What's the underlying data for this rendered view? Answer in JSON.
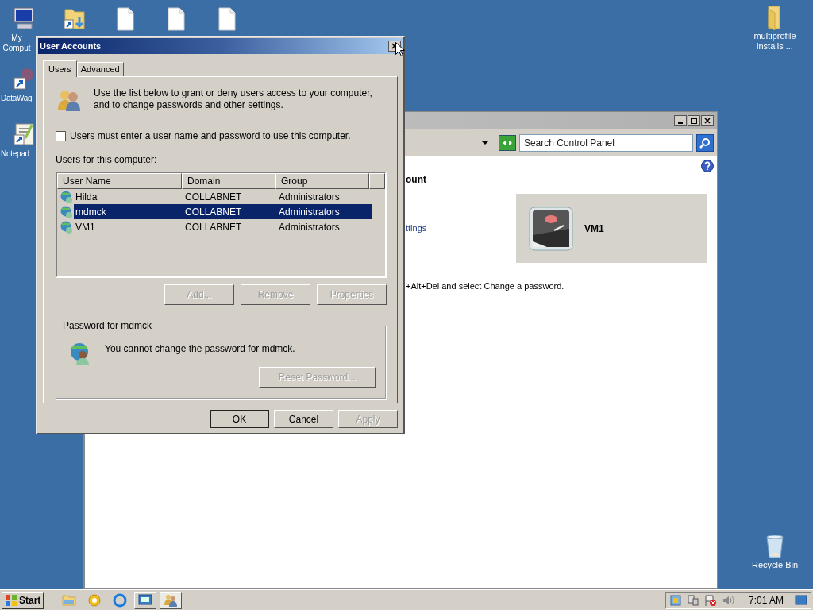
{
  "desktop_icons": [
    {
      "label": "My Comput",
      "kind": "computer"
    },
    {
      "kind": "folder-shortcut"
    },
    {
      "kind": "file"
    },
    {
      "kind": "file"
    },
    {
      "kind": "file"
    },
    {
      "label": "DataWag",
      "kind": "shortcut"
    },
    {
      "label": "Notepad",
      "kind": "notepad"
    },
    {
      "label": "multiprofile installs ...",
      "kind": "folder"
    },
    {
      "label": "Recycle Bin",
      "kind": "recycle"
    }
  ],
  "background_window": {
    "search": {
      "placeholder": "Search Control Panel"
    },
    "heading": "ount",
    "link": "ttings",
    "account": {
      "name": "VM1"
    },
    "note": "+Alt+Del and select Change a password."
  },
  "dialog": {
    "title": "User Accounts",
    "tabs": [
      {
        "label": "Users",
        "selected": true
      },
      {
        "label": "Advanced",
        "selected": false
      }
    ],
    "intro": "Use the list below to grant or deny users access to your computer, and to change passwords and other settings.",
    "require_login": {
      "label": "Users must enter a user name and password to use this computer.",
      "checked": false
    },
    "users_label": "Users for this computer:",
    "table": {
      "columns": [
        "User Name",
        "Domain",
        "Group"
      ],
      "rows": [
        {
          "cells": [
            "Hilda",
            "COLLABNET",
            "Administrators"
          ],
          "selected": false
        },
        {
          "cells": [
            "mdmck",
            "COLLABNET",
            "Administrators"
          ],
          "selected": true
        },
        {
          "cells": [
            "VM1",
            "COLLABNET",
            "Administrators"
          ],
          "selected": false
        }
      ]
    },
    "list_buttons": [
      {
        "label": "Add...",
        "disabled": true
      },
      {
        "label": "Remove",
        "disabled": true
      },
      {
        "label": "Properties",
        "disabled": true
      }
    ],
    "password_group": {
      "legend": "Password for mdmck",
      "message": "You cannot change the password for mdmck.",
      "button": {
        "label": "Reset Password...",
        "disabled": true
      }
    },
    "buttons": [
      {
        "label": "OK",
        "disabled": false
      },
      {
        "label": "Cancel",
        "disabled": false
      },
      {
        "label": "Apply",
        "disabled": true
      }
    ]
  },
  "taskbar": {
    "start": "Start",
    "time": "7:01 AM"
  }
}
